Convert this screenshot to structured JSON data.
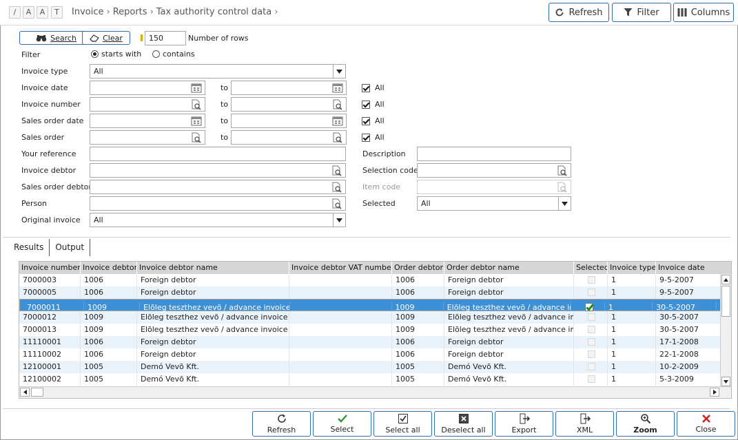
{
  "toolbar": {
    "small_buttons": [
      "/",
      "A",
      "A",
      "T"
    ],
    "breadcrumb": [
      "Invoice",
      "Reports",
      "Tax authority control data"
    ],
    "refresh_label": "Refresh",
    "filter_label": "Filter",
    "columns_label": "Columns"
  },
  "search": {
    "search_label": "Search",
    "clear_label": "Clear",
    "rows_value": "150",
    "rows_label": "Number of rows"
  },
  "filter": {
    "label": "Filter",
    "starts_with": "starts with",
    "contains": "contains",
    "selected_mode": "starts with"
  },
  "form": {
    "invoice_type_label": "Invoice type",
    "invoice_type_value": "All",
    "invoice_date_label": "Invoice date",
    "invoice_number_label": "Invoice number",
    "sales_order_date_label": "Sales order date",
    "sales_order_label": "Sales order",
    "to_label": "to",
    "all_label": "All",
    "your_reference_label": "Your reference",
    "invoice_debtor_label": "Invoice debtor",
    "sales_order_debtor_label": "Sales order debtor",
    "person_label": "Person",
    "original_invoice_label": "Original invoice",
    "original_invoice_value": "All",
    "description_label": "Description",
    "selection_code_label": "Selection code",
    "item_code_label": "Item code",
    "selected_label": "Selected",
    "selected_value": "All"
  },
  "tabs": [
    "Results",
    "Output"
  ],
  "grid": {
    "columns": [
      "Invoice number",
      "Invoice debtor",
      "Invoice debtor name",
      "Invoice debtor VAT number",
      "Order debtor",
      "Order debtor name",
      "Selected",
      "Invoice type",
      "Invoice date"
    ],
    "rows": [
      {
        "inv": "7000003",
        "deb": "1006",
        "name": "Foreign debtor",
        "vat": "",
        "odeb": "1006",
        "oname": "Foreign debtor",
        "sel": false,
        "type": "1",
        "date": "9-5-2007"
      },
      {
        "inv": "7000005",
        "deb": "1006",
        "name": "Foreign debtor",
        "vat": "",
        "odeb": "1006",
        "oname": "Foreign debtor",
        "sel": false,
        "type": "1",
        "date": "9-5-2007"
      },
      {
        "inv": "7000011",
        "deb": "1009",
        "name": "Elõleg teszthez vevõ / advance invoice test",
        "vat": "",
        "odeb": "1009",
        "oname": "Elõleg teszthez vevõ / advance invoi",
        "sel": true,
        "type": "1",
        "date": "30-5-2007"
      },
      {
        "inv": "7000012",
        "deb": "1009",
        "name": "Elõleg teszthez vevõ / advance invoice test",
        "vat": "",
        "odeb": "1009",
        "oname": "Elõleg teszthez vevõ / advance invoi",
        "sel": false,
        "type": "1",
        "date": "30-5-2007"
      },
      {
        "inv": "7000013",
        "deb": "1009",
        "name": "Elõleg teszthez vevõ / advance invoice test",
        "vat": "",
        "odeb": "1009",
        "oname": "Elõleg teszthez vevõ / advance invoi",
        "sel": false,
        "type": "1",
        "date": "30-5-2007"
      },
      {
        "inv": "11110001",
        "deb": "1006",
        "name": "Foreign debtor",
        "vat": "",
        "odeb": "1006",
        "oname": "Foreign debtor",
        "sel": false,
        "type": "1",
        "date": "17-1-2008"
      },
      {
        "inv": "11110002",
        "deb": "1006",
        "name": "Foreign debtor",
        "vat": "",
        "odeb": "1006",
        "oname": "Foreign debtor",
        "sel": false,
        "type": "1",
        "date": "22-1-2008"
      },
      {
        "inv": "12100001",
        "deb": "1005",
        "name": "Demó Vevõ Kft.",
        "vat": "",
        "odeb": "1005",
        "oname": "Demó Vevõ Kft.",
        "sel": false,
        "type": "1",
        "date": "10-2-2009"
      },
      {
        "inv": "12100002",
        "deb": "1005",
        "name": "Demó Vevõ Kft.",
        "vat": "",
        "odeb": "1005",
        "oname": "Demó Vevõ Kft.",
        "sel": false,
        "type": "1",
        "date": "5-3-2009"
      }
    ]
  },
  "bottom": {
    "refresh": "Refresh",
    "select": "Select",
    "select_all": "Select all",
    "deselect_all": "Deselect all",
    "export": "Export",
    "xml": "XML",
    "zoom": "Zoom",
    "close": "Close"
  }
}
